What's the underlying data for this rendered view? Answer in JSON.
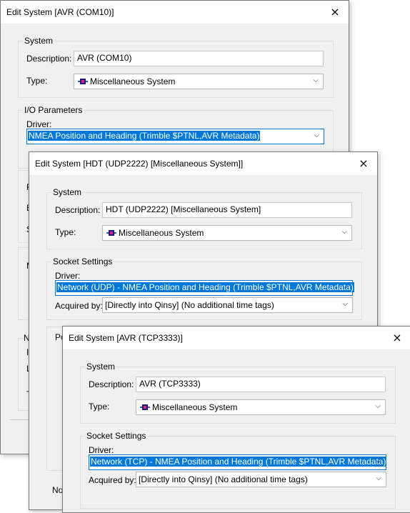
{
  "dialog1": {
    "title": "Edit System [AVR (COM10)]",
    "system_group": "System",
    "description_label": "Description:",
    "description_value": "AVR (COM10)",
    "type_label": "Type:",
    "type_value": "Miscellaneous System",
    "io_group": "I/O Parameters",
    "driver_label": "Driver:",
    "driver_value": "NMEA Position and Heading (Trimble $PTNL,AVR Metadata)",
    "clipped": [
      "F",
      "E",
      "S",
      "M",
      "N",
      "I",
      "L",
      "T"
    ]
  },
  "dialog2": {
    "title": "Edit System [HDT (UDP2222) [Miscellaneous System]]",
    "system_group": "System",
    "description_label": "Description:",
    "description_value": "HDT (UDP2222) [Miscellaneous System]",
    "type_label": "Type:",
    "type_value": "Miscellaneous System",
    "socket_group": "Socket Settings",
    "driver_label": "Driver:",
    "driver_value": "Network (UDP) - NMEA Position and Heading (Trimble $PTNL,AVR Metadata)",
    "acquired_label": "Acquired by:",
    "acquired_value": "[Directly into Qinsy] (No additional time tags)",
    "clipped": [
      "Po",
      "No"
    ]
  },
  "dialog3": {
    "title": "Edit System [AVR (TCP3333)]",
    "system_group": "System",
    "description_label": "Description:",
    "description_value": "AVR (TCP3333)",
    "type_label": "Type:",
    "type_value": "Miscellaneous System",
    "socket_group": "Socket Settings",
    "driver_label": "Driver:",
    "driver_value": "Network (TCP) - NMEA Position and Heading (Trimble $PTNL,AVR Metadata)",
    "acquired_label": "Acquired by:",
    "acquired_value": "[Directly into Qinsy] (No additional time tags)"
  },
  "icons": {
    "close": "×",
    "chevron": "⌵"
  }
}
